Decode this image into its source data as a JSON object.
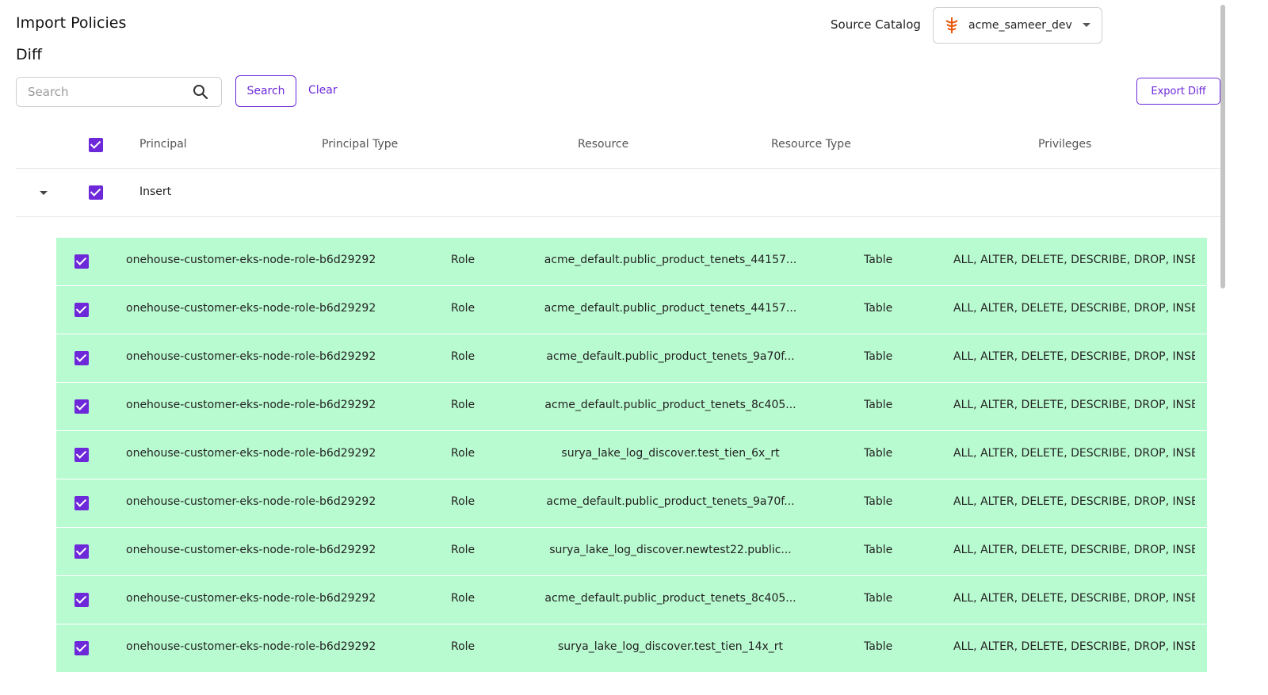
{
  "page": {
    "title": "Import Policies",
    "subtitle": "Diff"
  },
  "catalog": {
    "label": "Source Catalog",
    "selected": "acme_sameer_dev"
  },
  "search": {
    "placeholder": "Search",
    "value": "",
    "button_label": "Search",
    "clear_label": "Clear"
  },
  "export": {
    "label": "Export Diff"
  },
  "table": {
    "headers": {
      "principal": "Principal",
      "principal_type": "Principal Type",
      "resource": "Resource",
      "resource_type": "Resource Type",
      "privileges": "Privileges"
    },
    "group": {
      "label": "Insert",
      "checked": true
    },
    "rows": [
      {
        "principal": "onehouse-customer-eks-node-role-b6d29292",
        "principal_type": "Role",
        "resource": "acme_default.public_product_tenets_44157...",
        "resource_type": "Table",
        "privileges": "ALL, ALTER, DELETE, DESCRIBE, DROP, INSE...",
        "checked": true
      },
      {
        "principal": "onehouse-customer-eks-node-role-b6d29292",
        "principal_type": "Role",
        "resource": "acme_default.public_product_tenets_44157...",
        "resource_type": "Table",
        "privileges": "ALL, ALTER, DELETE, DESCRIBE, DROP, INSE...",
        "checked": true
      },
      {
        "principal": "onehouse-customer-eks-node-role-b6d29292",
        "principal_type": "Role",
        "resource": "acme_default.public_product_tenets_9a70f...",
        "resource_type": "Table",
        "privileges": "ALL, ALTER, DELETE, DESCRIBE, DROP, INSE...",
        "checked": true
      },
      {
        "principal": "onehouse-customer-eks-node-role-b6d29292",
        "principal_type": "Role",
        "resource": "acme_default.public_product_tenets_8c405...",
        "resource_type": "Table",
        "privileges": "ALL, ALTER, DELETE, DESCRIBE, DROP, INSE...",
        "checked": true
      },
      {
        "principal": "onehouse-customer-eks-node-role-b6d29292",
        "principal_type": "Role",
        "resource": "surya_lake_log_discover.test_tien_6x_rt",
        "resource_type": "Table",
        "privileges": "ALL, ALTER, DELETE, DESCRIBE, DROP, INSE...",
        "checked": true
      },
      {
        "principal": "onehouse-customer-eks-node-role-b6d29292",
        "principal_type": "Role",
        "resource": "acme_default.public_product_tenets_9a70f...",
        "resource_type": "Table",
        "privileges": "ALL, ALTER, DELETE, DESCRIBE, DROP, INSE...",
        "checked": true
      },
      {
        "principal": "onehouse-customer-eks-node-role-b6d29292",
        "principal_type": "Role",
        "resource": "surya_lake_log_discover.newtest22.public...",
        "resource_type": "Table",
        "privileges": "ALL, ALTER, DELETE, DESCRIBE, DROP, INSE...",
        "checked": true
      },
      {
        "principal": "onehouse-customer-eks-node-role-b6d29292",
        "principal_type": "Role",
        "resource": "acme_default.public_product_tenets_8c405...",
        "resource_type": "Table",
        "privileges": "ALL, ALTER, DELETE, DESCRIBE, DROP, INSE...",
        "checked": true
      },
      {
        "principal": "onehouse-customer-eks-node-role-b6d29292",
        "principal_type": "Role",
        "resource": "surya_lake_log_discover.test_tien_14x_rt",
        "resource_type": "Table",
        "privileges": "ALL, ALTER, DELETE, DESCRIBE, DROP, INSE...",
        "checked": true
      }
    ]
  },
  "colors": {
    "accent": "#6d28d9",
    "insert_row_bg": "#b9fbd0",
    "catalog_logo": "#e8590c"
  },
  "icons": {
    "search": "search-icon",
    "dropdown": "chevron-down-icon",
    "expand": "caret-down-icon",
    "catalog": "catalog-logo-icon"
  }
}
